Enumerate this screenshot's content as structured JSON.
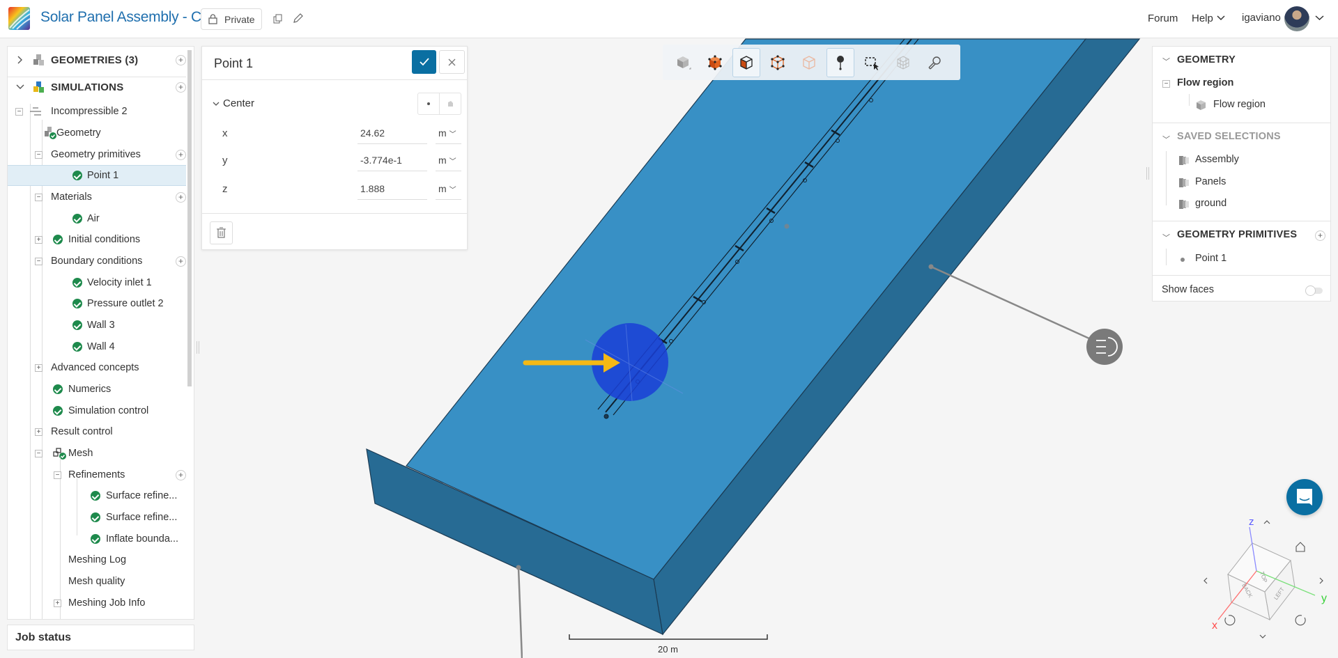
{
  "header": {
    "title": "Solar Panel Assembly - Copy",
    "privacy": "Private",
    "forum": "Forum",
    "help": "Help",
    "user": "igaviano"
  },
  "tree": {
    "geometries": "GEOMETRIES (3)",
    "simulations": "SIMULATIONS",
    "items": [
      "Incompressible 2",
      "Geometry",
      "Geometry primitives",
      "Point 1",
      "Materials",
      "Air",
      "Initial conditions",
      "Boundary conditions",
      "Velocity inlet 1",
      "Pressure outlet 2",
      "Wall 3",
      "Wall 4",
      "Advanced concepts",
      "Numerics",
      "Simulation control",
      "Result control",
      "Mesh",
      "Refinements",
      "Surface refine...",
      "Surface refine...",
      "Inflate bounda...",
      "Meshing Log",
      "Mesh quality",
      "Meshing Job Info"
    ],
    "job_status": "Job status"
  },
  "point_panel": {
    "title": "Point 1",
    "section": "Center",
    "fields": [
      {
        "label": "x",
        "value": "24.62",
        "unit": "m"
      },
      {
        "label": "y",
        "value": "-3.774e-1",
        "unit": "m"
      },
      {
        "label": "z",
        "value": "1.888",
        "unit": "m"
      }
    ]
  },
  "right_panel": {
    "geometry": "GEOMETRY",
    "flow_region_parent": "Flow region",
    "flow_region_child": "Flow region",
    "saved_selections": "SAVED SELECTIONS",
    "selections": [
      "Assembly",
      "Panels",
      "ground"
    ],
    "primitives": "GEOMETRY PRIMITIVES",
    "primitive_items": [
      "Point 1"
    ],
    "show_faces": "Show faces",
    "show_faces_on": false
  },
  "viewport": {
    "scale_label": "20 m",
    "axes": {
      "x": "x",
      "y": "y",
      "z": "z"
    },
    "cube_faces": {
      "top": "TOP",
      "back": "BACK",
      "left": "LEFT"
    }
  },
  "colors": {
    "accent": "#0a6fa2",
    "domain_top": "#3890c5",
    "domain_side": "#276b94",
    "point_sphere": "#1a3fd6",
    "arrow": "#f5b915",
    "check": "#1e8a4c"
  }
}
